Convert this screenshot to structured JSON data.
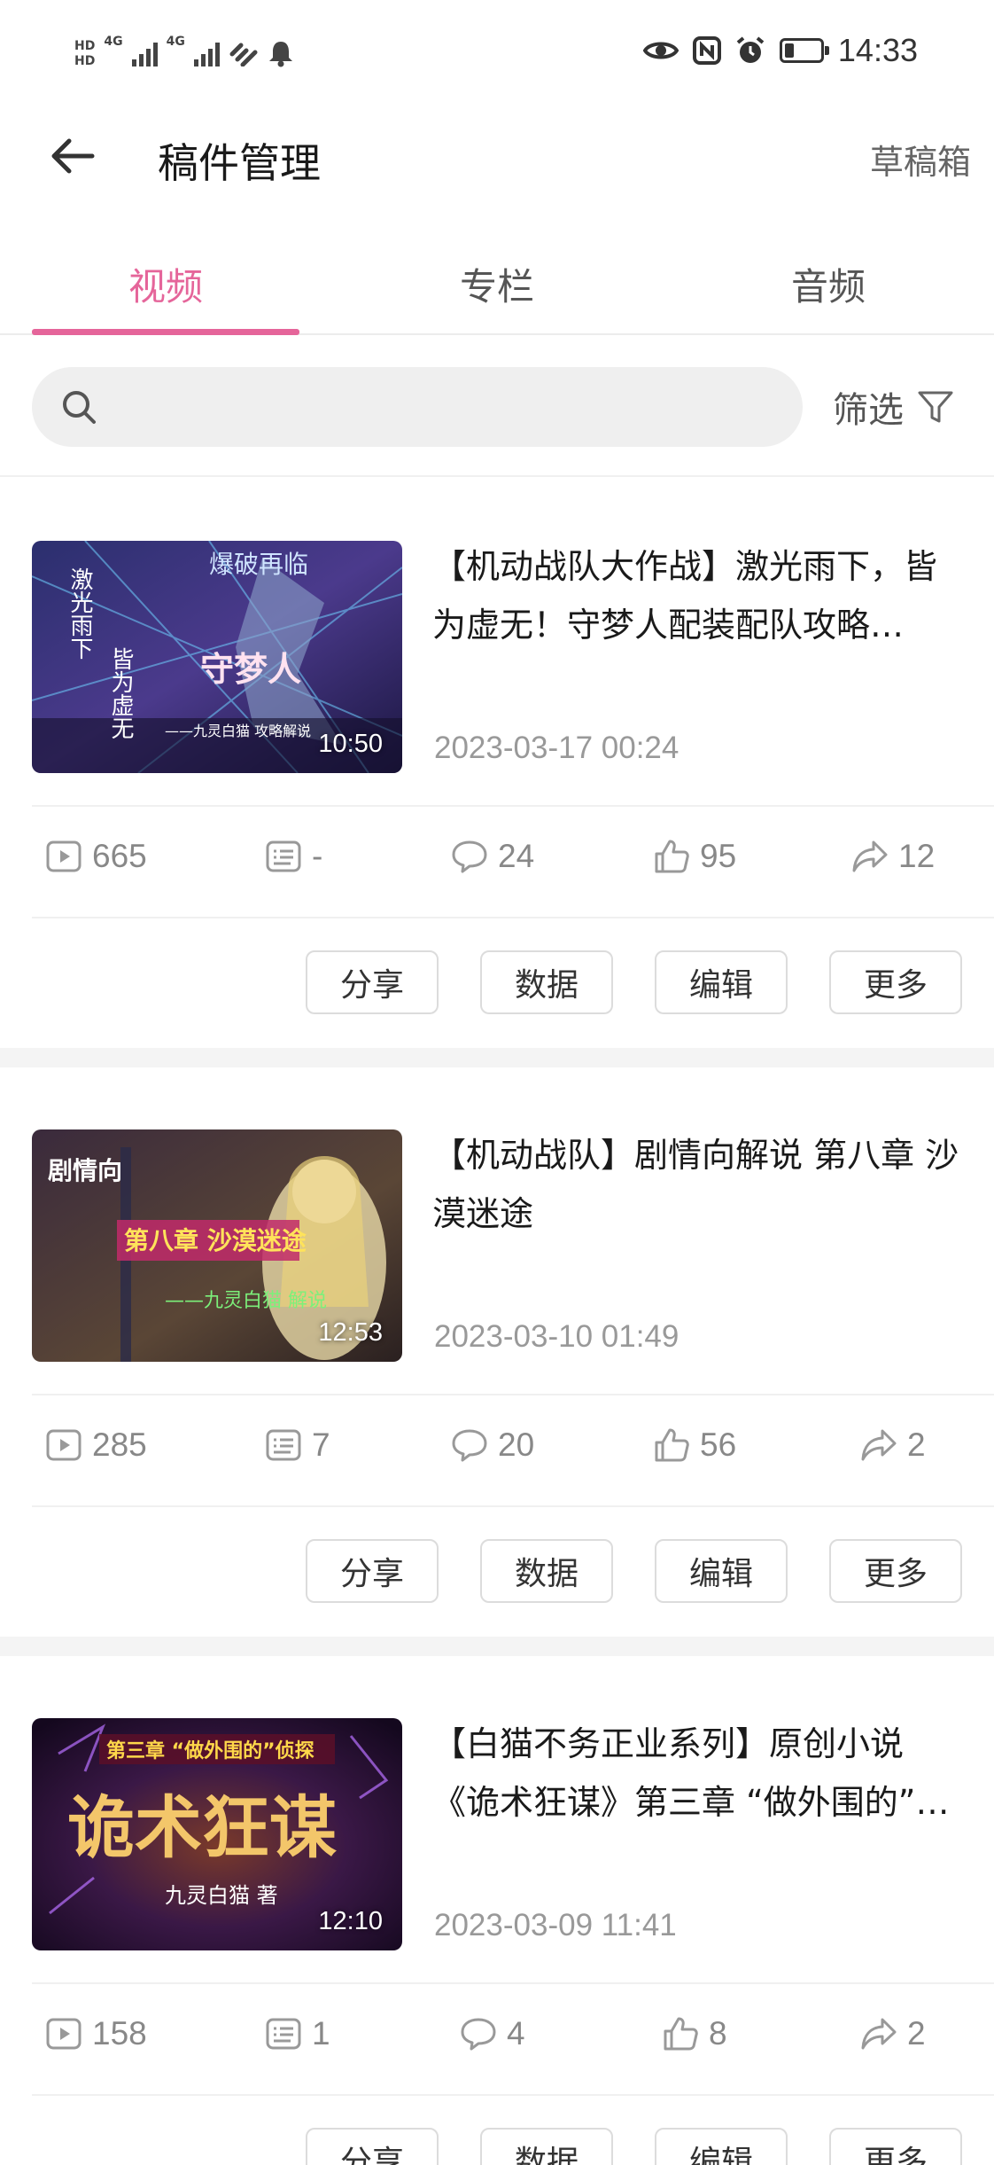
{
  "status_bar": {
    "left_labels": [
      "HD",
      "HD",
      "4G",
      "4G"
    ],
    "time": "14:33"
  },
  "header": {
    "title": "稿件管理",
    "right_action": "草稿箱"
  },
  "tabs": [
    {
      "label": "视频",
      "active": true
    },
    {
      "label": "专栏",
      "active": false
    },
    {
      "label": "音频",
      "active": false
    }
  ],
  "search": {
    "placeholder": ""
  },
  "filter": {
    "label": "筛选"
  },
  "actions": {
    "share": "分享",
    "data": "数据",
    "edit": "编辑",
    "more": "更多"
  },
  "videos": [
    {
      "title": "【机动战队大作战】激光雨下，皆为虚无！守梦人配装配队攻略…",
      "date": "2023-03-17 00:24",
      "duration": "10:50",
      "thumb_text": [
        "激光雨下",
        "皆为虚无",
        "爆破再临",
        "守梦人",
        "——九灵白猫 攻略解说"
      ],
      "views": "665",
      "danmaku": "-",
      "comments": "24",
      "likes": "95",
      "shares": "12"
    },
    {
      "title": "【机动战队】剧情向解说 第八章 沙漠迷途",
      "date": "2023-03-10 01:49",
      "duration": "12:53",
      "thumb_text": [
        "剧情向",
        "第八章 沙漠迷途",
        "——九灵白猫 解说"
      ],
      "views": "285",
      "danmaku": "7",
      "comments": "20",
      "likes": "56",
      "shares": "2"
    },
    {
      "title": "【白猫不务正业系列】原创小说《诡术狂谋》第三章 “做外围的”…",
      "date": "2023-03-09 11:41",
      "duration": "12:10",
      "thumb_text": [
        "第三章 “做外围的”侦探",
        "诡术狂谋",
        "九灵白猫 著"
      ],
      "views": "158",
      "danmaku": "1",
      "comments": "4",
      "likes": "8",
      "shares": "2"
    }
  ],
  "colors": {
    "accent": "#e5659a",
    "text_primary": "#1a1a1a",
    "text_secondary": "#999999",
    "divider": "#f0f0f0"
  }
}
